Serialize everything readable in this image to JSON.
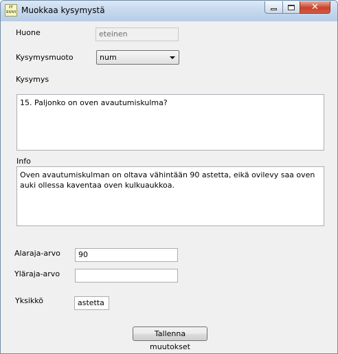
{
  "window": {
    "title": "Muokkaa kysymystä",
    "icon_text": "IT\nSUVI"
  },
  "form": {
    "room_label": "Huone",
    "room_value": "eteinen",
    "question_type_label": "Kysymysmuoto",
    "question_type_value": "num",
    "question_label": "Kysymys",
    "question_value": "15. Paljonko on oven avautumiskulma?",
    "info_label": "Info",
    "info_value": "Oven avautumiskulman on oltava vähintään 90 astetta, eikä ovilevy saa oven auki ollessa kaventaa oven kulkuaukkoa.",
    "lower_label": "Alaraja-arvo",
    "lower_value": "90",
    "upper_label": "Yläraja-arvo",
    "upper_value": "",
    "unit_label": "Yksikkö",
    "unit_value": "astetta",
    "save_button": "Tallenna muutokset"
  },
  "icons": {
    "minimize": "minimize-icon",
    "maximize": "maximize-icon",
    "close": "close-icon",
    "combo_arrow": "chevron-down-icon"
  },
  "colors": {
    "titlebar": "#c7d9ee",
    "client_bg": "#f0f0f0",
    "close_button": "#c9422d"
  }
}
